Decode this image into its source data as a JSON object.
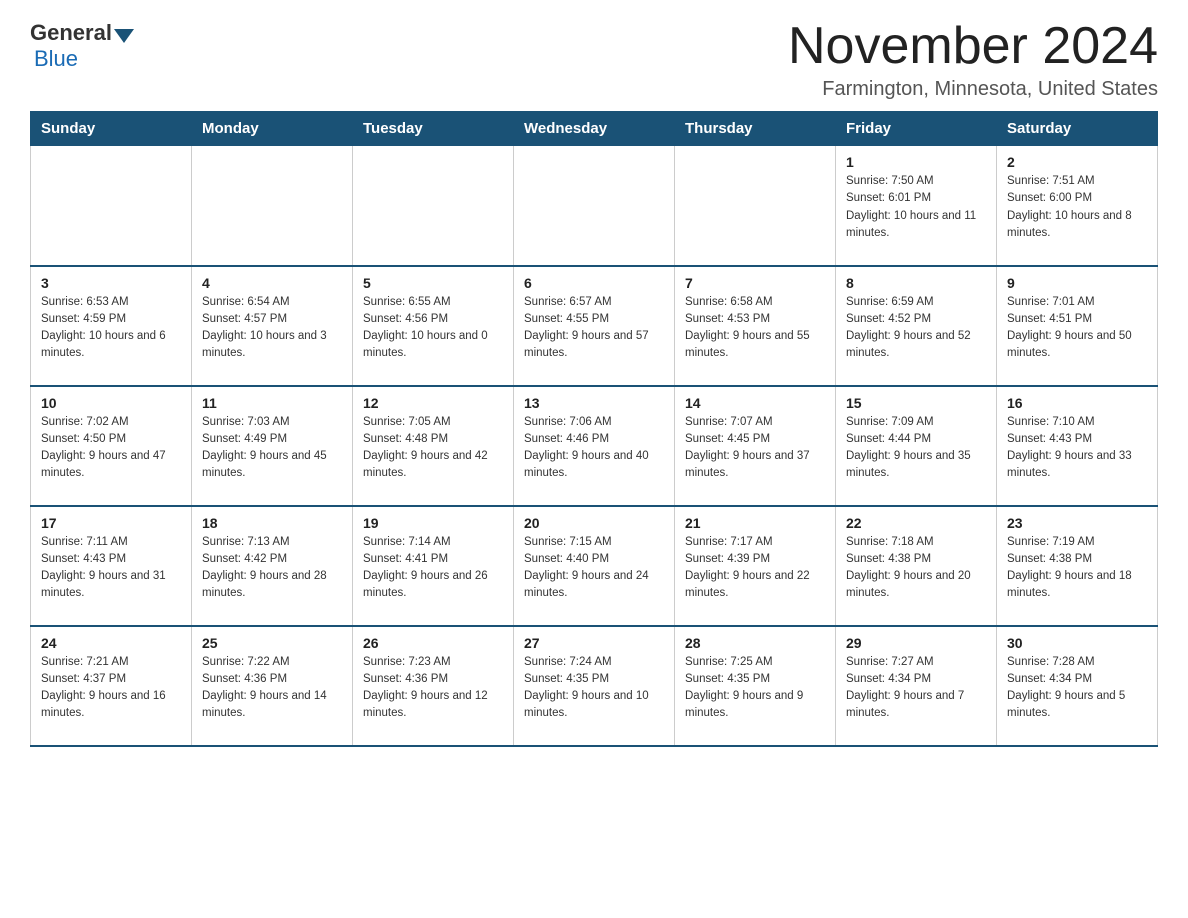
{
  "logo": {
    "general": "General",
    "blue": "Blue"
  },
  "header": {
    "month_year": "November 2024",
    "location": "Farmington, Minnesota, United States"
  },
  "weekdays": [
    "Sunday",
    "Monday",
    "Tuesday",
    "Wednesday",
    "Thursday",
    "Friday",
    "Saturday"
  ],
  "weeks": [
    [
      {
        "day": "",
        "info": ""
      },
      {
        "day": "",
        "info": ""
      },
      {
        "day": "",
        "info": ""
      },
      {
        "day": "",
        "info": ""
      },
      {
        "day": "",
        "info": ""
      },
      {
        "day": "1",
        "info": "Sunrise: 7:50 AM\nSunset: 6:01 PM\nDaylight: 10 hours and 11 minutes."
      },
      {
        "day": "2",
        "info": "Sunrise: 7:51 AM\nSunset: 6:00 PM\nDaylight: 10 hours and 8 minutes."
      }
    ],
    [
      {
        "day": "3",
        "info": "Sunrise: 6:53 AM\nSunset: 4:59 PM\nDaylight: 10 hours and 6 minutes."
      },
      {
        "day": "4",
        "info": "Sunrise: 6:54 AM\nSunset: 4:57 PM\nDaylight: 10 hours and 3 minutes."
      },
      {
        "day": "5",
        "info": "Sunrise: 6:55 AM\nSunset: 4:56 PM\nDaylight: 10 hours and 0 minutes."
      },
      {
        "day": "6",
        "info": "Sunrise: 6:57 AM\nSunset: 4:55 PM\nDaylight: 9 hours and 57 minutes."
      },
      {
        "day": "7",
        "info": "Sunrise: 6:58 AM\nSunset: 4:53 PM\nDaylight: 9 hours and 55 minutes."
      },
      {
        "day": "8",
        "info": "Sunrise: 6:59 AM\nSunset: 4:52 PM\nDaylight: 9 hours and 52 minutes."
      },
      {
        "day": "9",
        "info": "Sunrise: 7:01 AM\nSunset: 4:51 PM\nDaylight: 9 hours and 50 minutes."
      }
    ],
    [
      {
        "day": "10",
        "info": "Sunrise: 7:02 AM\nSunset: 4:50 PM\nDaylight: 9 hours and 47 minutes."
      },
      {
        "day": "11",
        "info": "Sunrise: 7:03 AM\nSunset: 4:49 PM\nDaylight: 9 hours and 45 minutes."
      },
      {
        "day": "12",
        "info": "Sunrise: 7:05 AM\nSunset: 4:48 PM\nDaylight: 9 hours and 42 minutes."
      },
      {
        "day": "13",
        "info": "Sunrise: 7:06 AM\nSunset: 4:46 PM\nDaylight: 9 hours and 40 minutes."
      },
      {
        "day": "14",
        "info": "Sunrise: 7:07 AM\nSunset: 4:45 PM\nDaylight: 9 hours and 37 minutes."
      },
      {
        "day": "15",
        "info": "Sunrise: 7:09 AM\nSunset: 4:44 PM\nDaylight: 9 hours and 35 minutes."
      },
      {
        "day": "16",
        "info": "Sunrise: 7:10 AM\nSunset: 4:43 PM\nDaylight: 9 hours and 33 minutes."
      }
    ],
    [
      {
        "day": "17",
        "info": "Sunrise: 7:11 AM\nSunset: 4:43 PM\nDaylight: 9 hours and 31 minutes."
      },
      {
        "day": "18",
        "info": "Sunrise: 7:13 AM\nSunset: 4:42 PM\nDaylight: 9 hours and 28 minutes."
      },
      {
        "day": "19",
        "info": "Sunrise: 7:14 AM\nSunset: 4:41 PM\nDaylight: 9 hours and 26 minutes."
      },
      {
        "day": "20",
        "info": "Sunrise: 7:15 AM\nSunset: 4:40 PM\nDaylight: 9 hours and 24 minutes."
      },
      {
        "day": "21",
        "info": "Sunrise: 7:17 AM\nSunset: 4:39 PM\nDaylight: 9 hours and 22 minutes."
      },
      {
        "day": "22",
        "info": "Sunrise: 7:18 AM\nSunset: 4:38 PM\nDaylight: 9 hours and 20 minutes."
      },
      {
        "day": "23",
        "info": "Sunrise: 7:19 AM\nSunset: 4:38 PM\nDaylight: 9 hours and 18 minutes."
      }
    ],
    [
      {
        "day": "24",
        "info": "Sunrise: 7:21 AM\nSunset: 4:37 PM\nDaylight: 9 hours and 16 minutes."
      },
      {
        "day": "25",
        "info": "Sunrise: 7:22 AM\nSunset: 4:36 PM\nDaylight: 9 hours and 14 minutes."
      },
      {
        "day": "26",
        "info": "Sunrise: 7:23 AM\nSunset: 4:36 PM\nDaylight: 9 hours and 12 minutes."
      },
      {
        "day": "27",
        "info": "Sunrise: 7:24 AM\nSunset: 4:35 PM\nDaylight: 9 hours and 10 minutes."
      },
      {
        "day": "28",
        "info": "Sunrise: 7:25 AM\nSunset: 4:35 PM\nDaylight: 9 hours and 9 minutes."
      },
      {
        "day": "29",
        "info": "Sunrise: 7:27 AM\nSunset: 4:34 PM\nDaylight: 9 hours and 7 minutes."
      },
      {
        "day": "30",
        "info": "Sunrise: 7:28 AM\nSunset: 4:34 PM\nDaylight: 9 hours and 5 minutes."
      }
    ]
  ]
}
